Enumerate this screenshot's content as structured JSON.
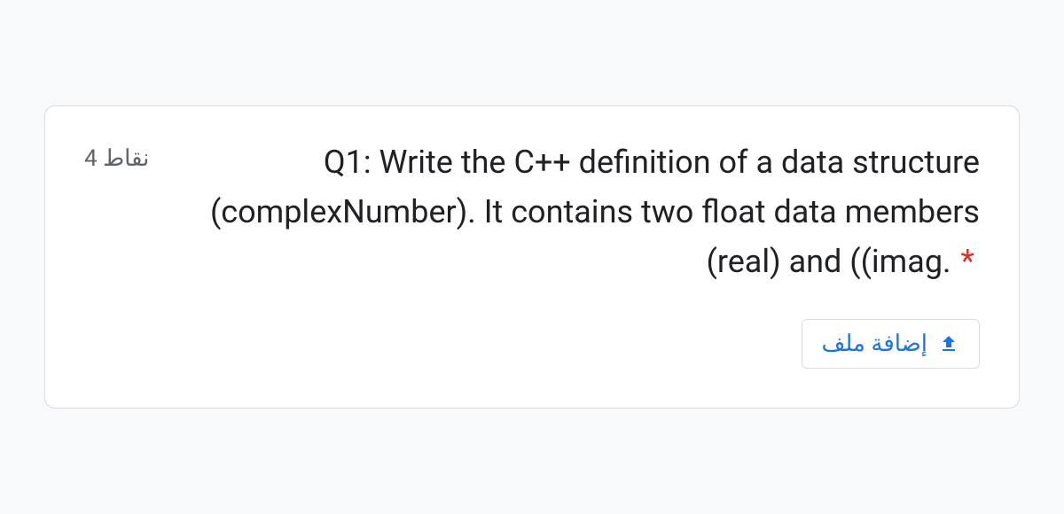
{
  "question": {
    "points_label": "4 نقاط",
    "text": "Q1: Write the C++ definition of a data structure (complexNumber). It contains two float data members (real) and ((imag.",
    "required_marker": "*"
  },
  "upload": {
    "label": "إضافة ملف",
    "icon_name": "upload-icon"
  }
}
